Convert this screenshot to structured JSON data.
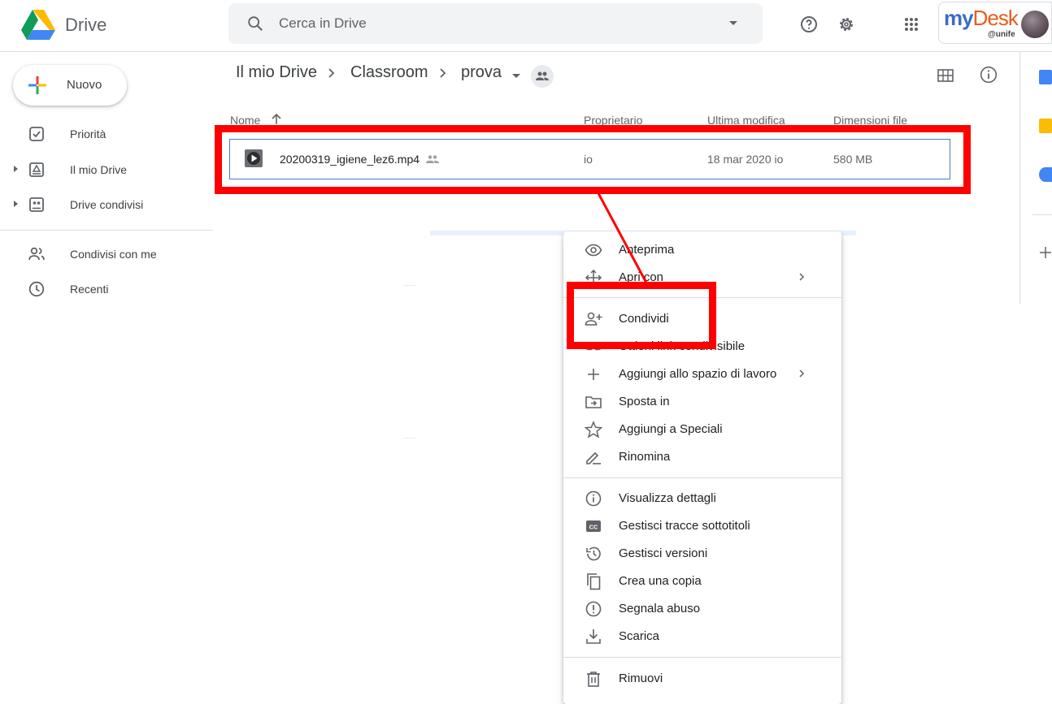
{
  "header": {
    "app_name": "Drive",
    "search_placeholder": "Cerca in Drive",
    "mydesk_brand_my": "my",
    "mydesk_brand_desk": "Desk",
    "mydesk_sub": "@unife"
  },
  "sidebar": {
    "new_label": "Nuovo",
    "items": [
      {
        "label": "Priorità",
        "icon": "check-box-icon"
      },
      {
        "label": "Il mio Drive",
        "icon": "my-drive-icon"
      },
      {
        "label": "Drive condivisi",
        "icon": "shared-drives-icon"
      },
      {
        "label": "Condivisi con me",
        "icon": "people-icon"
      },
      {
        "label": "Recenti",
        "icon": "clock-icon"
      }
    ]
  },
  "breadcrumb": {
    "items": [
      "Il mio Drive",
      "Classroom",
      "prova"
    ]
  },
  "file_list": {
    "columns": {
      "name": "Nome",
      "owner": "Proprietario",
      "modified": "Ultima modifica",
      "size": "Dimensioni file"
    },
    "rows": [
      {
        "name": "20200319_igiene_lez6.mp4",
        "owner": "io",
        "modified": "18 mar 2020 io",
        "size": "580 MB"
      }
    ]
  },
  "context_menu": {
    "items": [
      {
        "label": "Anteprima",
        "icon": "eye-icon"
      },
      {
        "label": "Apri con",
        "icon": "move-arrows-icon",
        "submenu": true
      },
      {
        "label": "Condividi",
        "icon": "person-add-icon"
      },
      {
        "label": "Ottieni link condivisibile",
        "icon": "link-icon"
      },
      {
        "label": "Aggiungi allo spazio di lavoro",
        "icon": "plus-icon",
        "submenu": true
      },
      {
        "label": "Sposta in",
        "icon": "move-to-folder-icon"
      },
      {
        "label": "Aggiungi a Speciali",
        "icon": "star-icon"
      },
      {
        "label": "Rinomina",
        "icon": "pencil-icon"
      },
      {
        "label": "Visualizza dettagli",
        "icon": "info-icon"
      },
      {
        "label": "Gestisci tracce sottotitoli",
        "icon": "cc-icon"
      },
      {
        "label": "Gestisci versioni",
        "icon": "history-icon"
      },
      {
        "label": "Crea una copia",
        "icon": "copy-icon"
      },
      {
        "label": "Segnala abuso",
        "icon": "report-icon"
      },
      {
        "label": "Scarica",
        "icon": "download-icon"
      },
      {
        "label": "Rimuovi",
        "icon": "trash-icon"
      }
    ]
  },
  "colors": {
    "annotation": "#ff0000",
    "selection_border": "#4e77c9",
    "accent_blue": "#1a73e8"
  }
}
